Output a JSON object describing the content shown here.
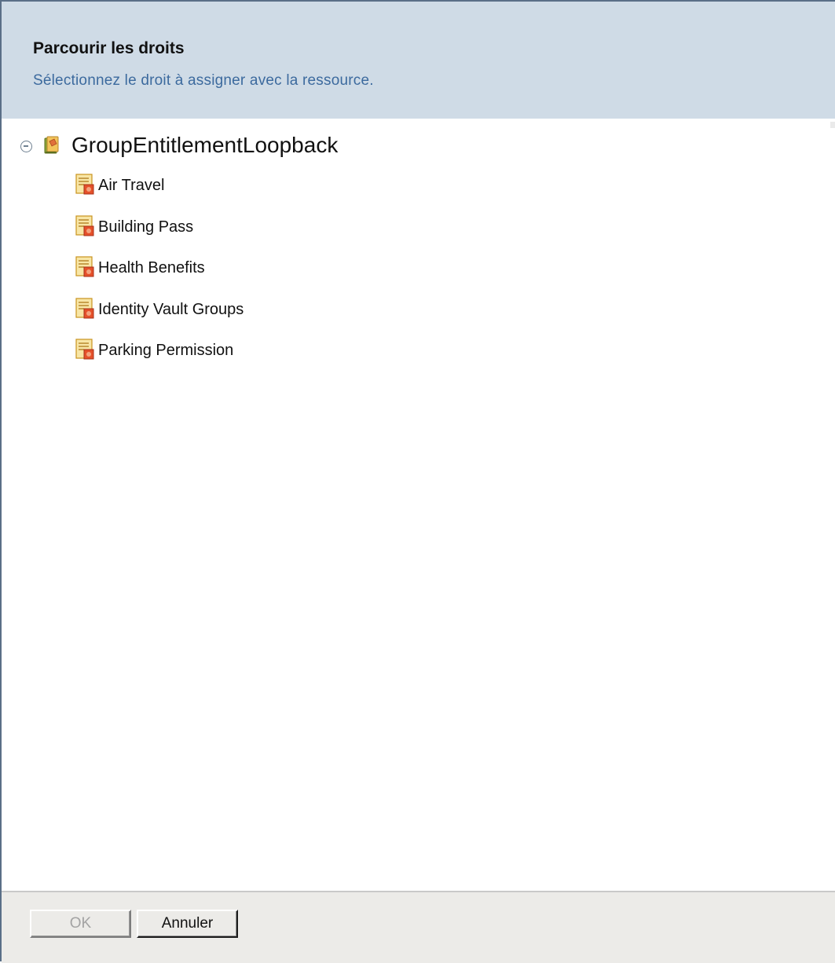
{
  "dialog": {
    "title": "Parcourir les droits",
    "subtitle": "Sélectionnez le droit à assigner avec la ressource."
  },
  "tree": {
    "root": {
      "label": "GroupEntitlementLoopback",
      "expanded": true,
      "icon": "driver-book-icon"
    },
    "items": [
      {
        "label": "Air Travel",
        "icon": "entitlement-icon"
      },
      {
        "label": "Building Pass",
        "icon": "entitlement-icon"
      },
      {
        "label": "Health Benefits",
        "icon": "entitlement-icon"
      },
      {
        "label": "Identity Vault Groups",
        "icon": "entitlement-icon"
      },
      {
        "label": "Parking Permission",
        "icon": "entitlement-icon"
      }
    ]
  },
  "footer": {
    "ok_label": "OK",
    "ok_enabled": false,
    "cancel_label": "Annuler"
  },
  "colors": {
    "header_bg": "#cfdbe6",
    "subtitle": "#3c6a9e",
    "footer_bg": "#ecebe8"
  }
}
